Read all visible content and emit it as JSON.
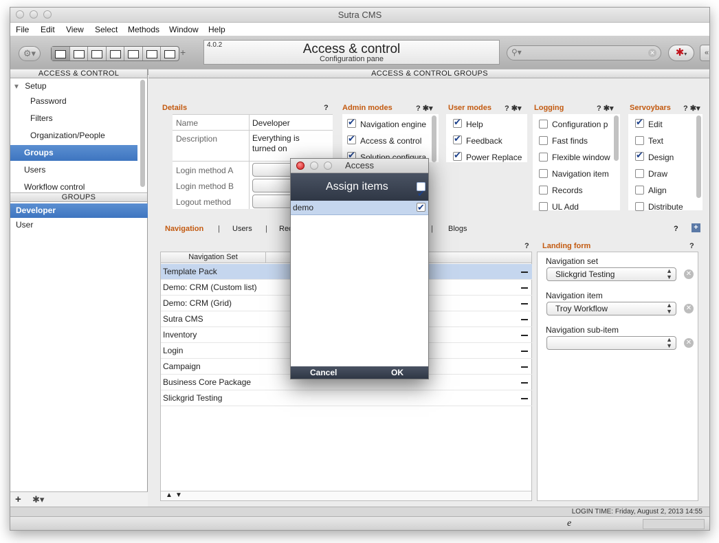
{
  "window": {
    "title": "Sutra CMS"
  },
  "menu": [
    "File",
    "Edit",
    "View",
    "Select",
    "Methods",
    "Window",
    "Help"
  ],
  "toolbar": {
    "version": "4.0.2",
    "title": "Access & control",
    "subtitle": "Configuration pane"
  },
  "left_panel": {
    "header": "ACCESS & CONTROL",
    "setup_label": "Setup",
    "items": [
      "Password",
      "Filters",
      "Organization/People",
      "Groups",
      "Users",
      "Workflow control"
    ],
    "groups_header": "GROUPS",
    "groups": [
      "Developer",
      "User"
    ]
  },
  "main": {
    "header": "ACCESS & CONTROL GROUPS",
    "details": {
      "title": "Details",
      "help": "?",
      "fields": [
        {
          "label": "Name",
          "value": "Developer"
        },
        {
          "label": "Description",
          "value_line1": "Everything is",
          "value_line2": "turned on"
        },
        {
          "label": "Login method A"
        },
        {
          "label": "Login method B"
        },
        {
          "label": "Logout method"
        }
      ]
    },
    "admin_modes": {
      "title": "Admin modes",
      "items": [
        {
          "label": "Navigation engine",
          "checked": true
        },
        {
          "label": "Access & control",
          "checked": true
        },
        {
          "label": "Solution configura",
          "checked": true
        }
      ]
    },
    "user_modes": {
      "title": "User modes",
      "items": [
        {
          "label": "Help",
          "checked": true
        },
        {
          "label": "Feedback",
          "checked": true
        },
        {
          "label": "Power Replace",
          "checked": true
        }
      ]
    },
    "logging": {
      "title": "Logging",
      "items": [
        {
          "label": "Configuration p",
          "checked": false
        },
        {
          "label": "Fast finds",
          "checked": false
        },
        {
          "label": "Flexible window",
          "checked": false
        },
        {
          "label": "Navigation item",
          "checked": false
        },
        {
          "label": "Records",
          "checked": false
        },
        {
          "label": "UL Add",
          "checked": false
        }
      ]
    },
    "servoybars": {
      "title": "Servoybars",
      "items": [
        {
          "label": "Edit",
          "checked": true
        },
        {
          "label": "Text",
          "checked": false
        },
        {
          "label": "Design",
          "checked": true
        },
        {
          "label": "Draw",
          "checked": false
        },
        {
          "label": "Align",
          "checked": false
        },
        {
          "label": "Distribute",
          "checked": false
        }
      ]
    },
    "tabs": [
      "Navigation",
      "Users",
      "Rec",
      "Blogs"
    ],
    "nav_table": {
      "column": "Navigation Set",
      "rows": [
        "Template Pack",
        "Demo: CRM (Custom list)",
        "Demo: CRM (Grid)",
        "Sutra CMS",
        "Inventory",
        "Login",
        "Campaign",
        "Business Core Package",
        "Slickgrid Testing"
      ]
    },
    "landing_form": {
      "title": "Landing form",
      "nav_set_label": "Navigation set",
      "nav_set_value": "Slickgrid Testing",
      "nav_item_label": "Navigation item",
      "nav_item_value": "Troy Workflow",
      "nav_subitem_label": "Navigation sub-item",
      "nav_subitem_value": ""
    }
  },
  "status": {
    "login_time": "LOGIN TIME: Friday, August 2, 2013 14:55",
    "browser_glyph": "e"
  },
  "dialog": {
    "title": "Access",
    "header": "Assign items",
    "header_checked": true,
    "rows": [
      {
        "label": "demo",
        "checked": true
      }
    ],
    "cancel": "Cancel",
    "ok": "OK"
  }
}
